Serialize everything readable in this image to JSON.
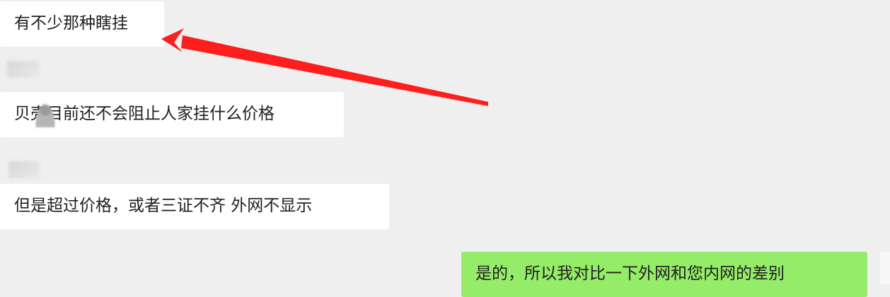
{
  "chat": {
    "messages": [
      {
        "side": "received",
        "text": "有不少那种瞎挂"
      },
      {
        "side": "received",
        "text": "贝壳目前还不会阻止人家挂什么价格"
      },
      {
        "side": "received",
        "text": "但是超过价格，或者三证不齐 外网不显示"
      },
      {
        "side": "sent",
        "text": "是的，所以我对比一下外网和您内网的差别"
      }
    ]
  },
  "annotation": {
    "type": "red-arrow",
    "color": "#ff1e1e"
  },
  "colors": {
    "background": "#efefef",
    "received_bubble": "#ffffff",
    "sent_bubble": "#95ec69"
  }
}
